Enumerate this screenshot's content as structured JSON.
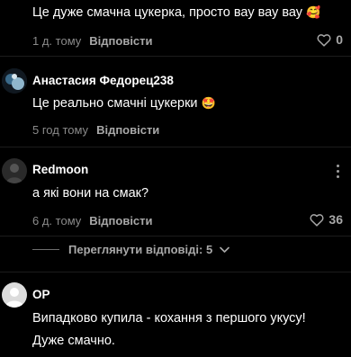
{
  "comments": [
    {
      "text": "Це дуже смачна цукерка, просто вау вау вау",
      "emoji": "🥰",
      "time": "1 д. тому",
      "reply_label": "Відповісти",
      "likes": "0"
    },
    {
      "author": "Анастасия Федорец238",
      "text": "Це реально смачні цукерки",
      "emoji": "🤩",
      "time": "5 год тому",
      "reply_label": "Відповісти"
    },
    {
      "author": "Redmoon",
      "text": "а які вони на смак?",
      "time": "6 д. тому",
      "reply_label": "Відповісти",
      "likes": "36"
    },
    {
      "author": "OP",
      "text_line1": "Випадково купила - кохання з першого укусу!",
      "text_line2": "Дуже смачно."
    }
  ],
  "view_replies": "Переглянути відповіді: 5",
  "icons": {
    "like": "heart-outline-icon",
    "more": "more-vertical-icon",
    "expand": "chevron-down-icon"
  },
  "colors": {
    "background": "#000000",
    "text": "#ffffff",
    "muted": "#8a8a8a"
  }
}
